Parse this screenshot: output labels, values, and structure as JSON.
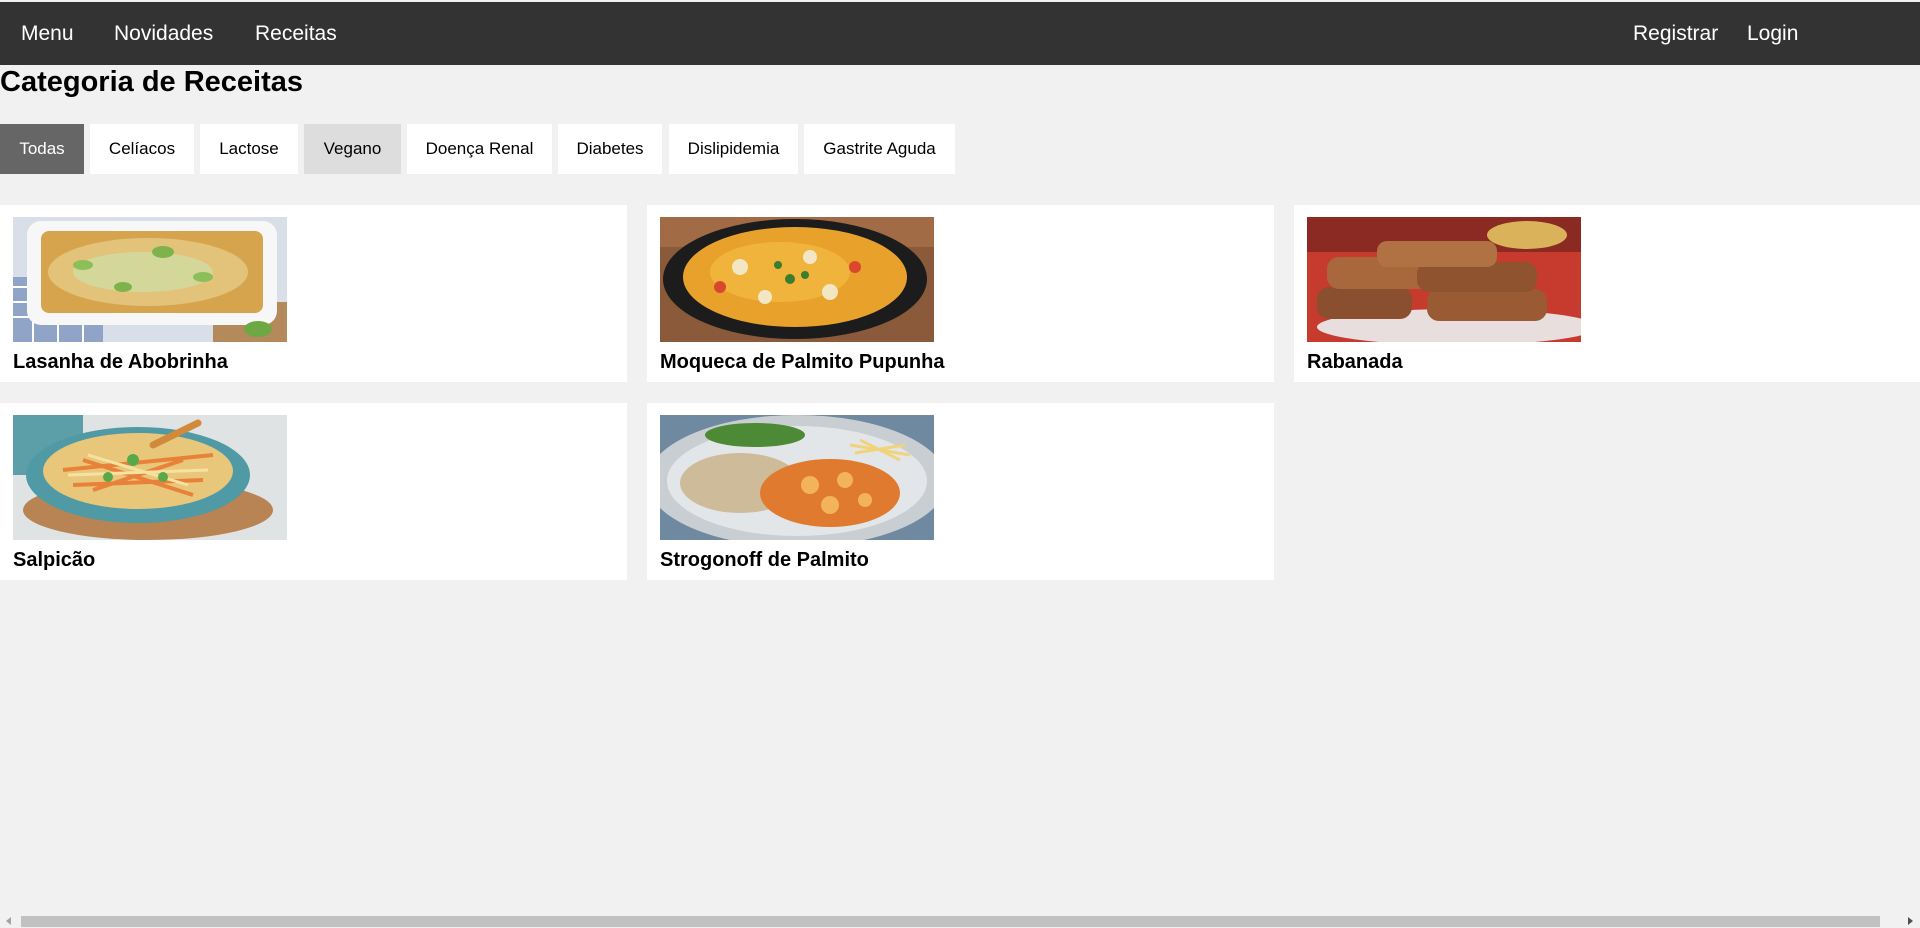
{
  "nav": {
    "left": [
      "Menu",
      "Novidades",
      "Receitas"
    ],
    "right": [
      "Registrar",
      "Login"
    ]
  },
  "page_title": "Categoria de Receitas",
  "categories": [
    "Todas",
    "Celíacos",
    "Lactose",
    "Vegano",
    "Doença Renal",
    "Diabetes",
    "Dislipidemia",
    "Gastrite Aguda"
  ],
  "active_category": "Todas",
  "recipes": [
    {
      "title": "Lasanha de Abobrinha",
      "image": "lasagna-photo"
    },
    {
      "title": "Moqueca de Palmito Pupunha",
      "image": "moqueca-photo"
    },
    {
      "title": "Rabanada",
      "image": "rabanada-photo"
    },
    {
      "title": "Salpicão",
      "image": "salpicao-photo"
    },
    {
      "title": "Strogonoff de Palmito",
      "image": "strogonoff-photo"
    }
  ],
  "colors": {
    "navbar": "#333333",
    "background": "#f1f1f1",
    "active_category": "#666666",
    "hover_category": "#dddddd",
    "card": "#ffffff"
  }
}
